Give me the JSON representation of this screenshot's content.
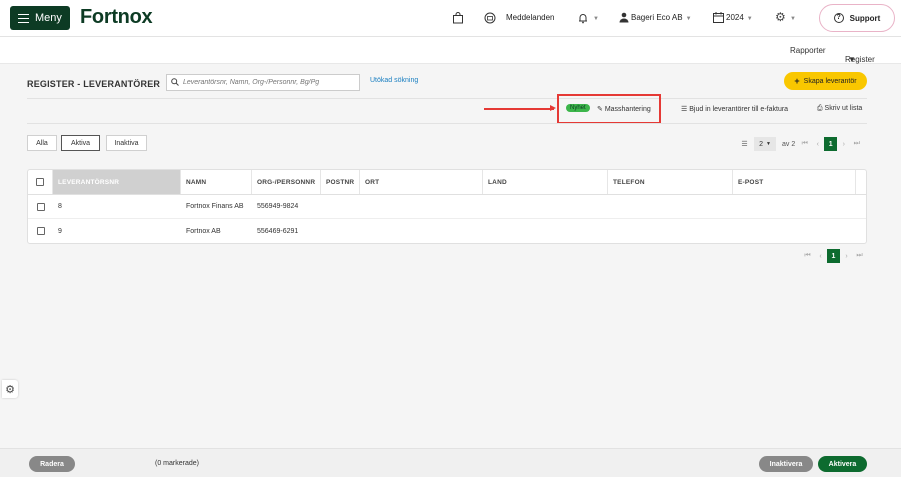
{
  "header": {
    "menu_label": "Meny",
    "logo": "Fortnox",
    "messages_label": "Meddelanden",
    "company_label": "Bageri Eco AB",
    "year_label": "2024",
    "support_label": "Support"
  },
  "subnav": {
    "reports_label": "Rapporter",
    "register_label": "Register"
  },
  "page": {
    "title": "REGISTER - LEVERANTÖRER",
    "search_placeholder": "Leverantörsnr, Namn, Org-/Personnr, Bg/Pg",
    "advanced_search": "Utökad sökning",
    "create_button": "Skapa leverantör"
  },
  "toolbar": {
    "new_badge": "Nyhet",
    "mass_edit": "Masshantering",
    "invite": "Bjud in leverantörer till e-faktura",
    "print": "Skriv ut lista"
  },
  "filters": [
    "Alla",
    "Aktiva",
    "Inaktiva"
  ],
  "pagination": {
    "page_size": "2",
    "of_label": "av 2",
    "current_page": "1"
  },
  "table": {
    "columns": [
      "LEVERANTÖRSNR",
      "NAMN",
      "ORG-/PERSONNR",
      "POSTNR",
      "ORT",
      "LAND",
      "TELEFON",
      "E-POST"
    ],
    "rows": [
      {
        "nr": "8",
        "name": "Fortnox Finans AB",
        "org": "556949-9824"
      },
      {
        "nr": "9",
        "name": "Fortnox AB",
        "org": "556469-6291"
      }
    ]
  },
  "footer": {
    "delete_label": "Radera",
    "marked_label": "(0 markerade)",
    "deactivate_label": "Inaktivera",
    "activate_label": "Aktivera"
  },
  "colors": {
    "brand_dark": "#0d3b24",
    "create_button": "#f9c700",
    "highlight": "#e53935",
    "badge_green": "#3cb54a",
    "activate_green": "#0d6b2f"
  }
}
